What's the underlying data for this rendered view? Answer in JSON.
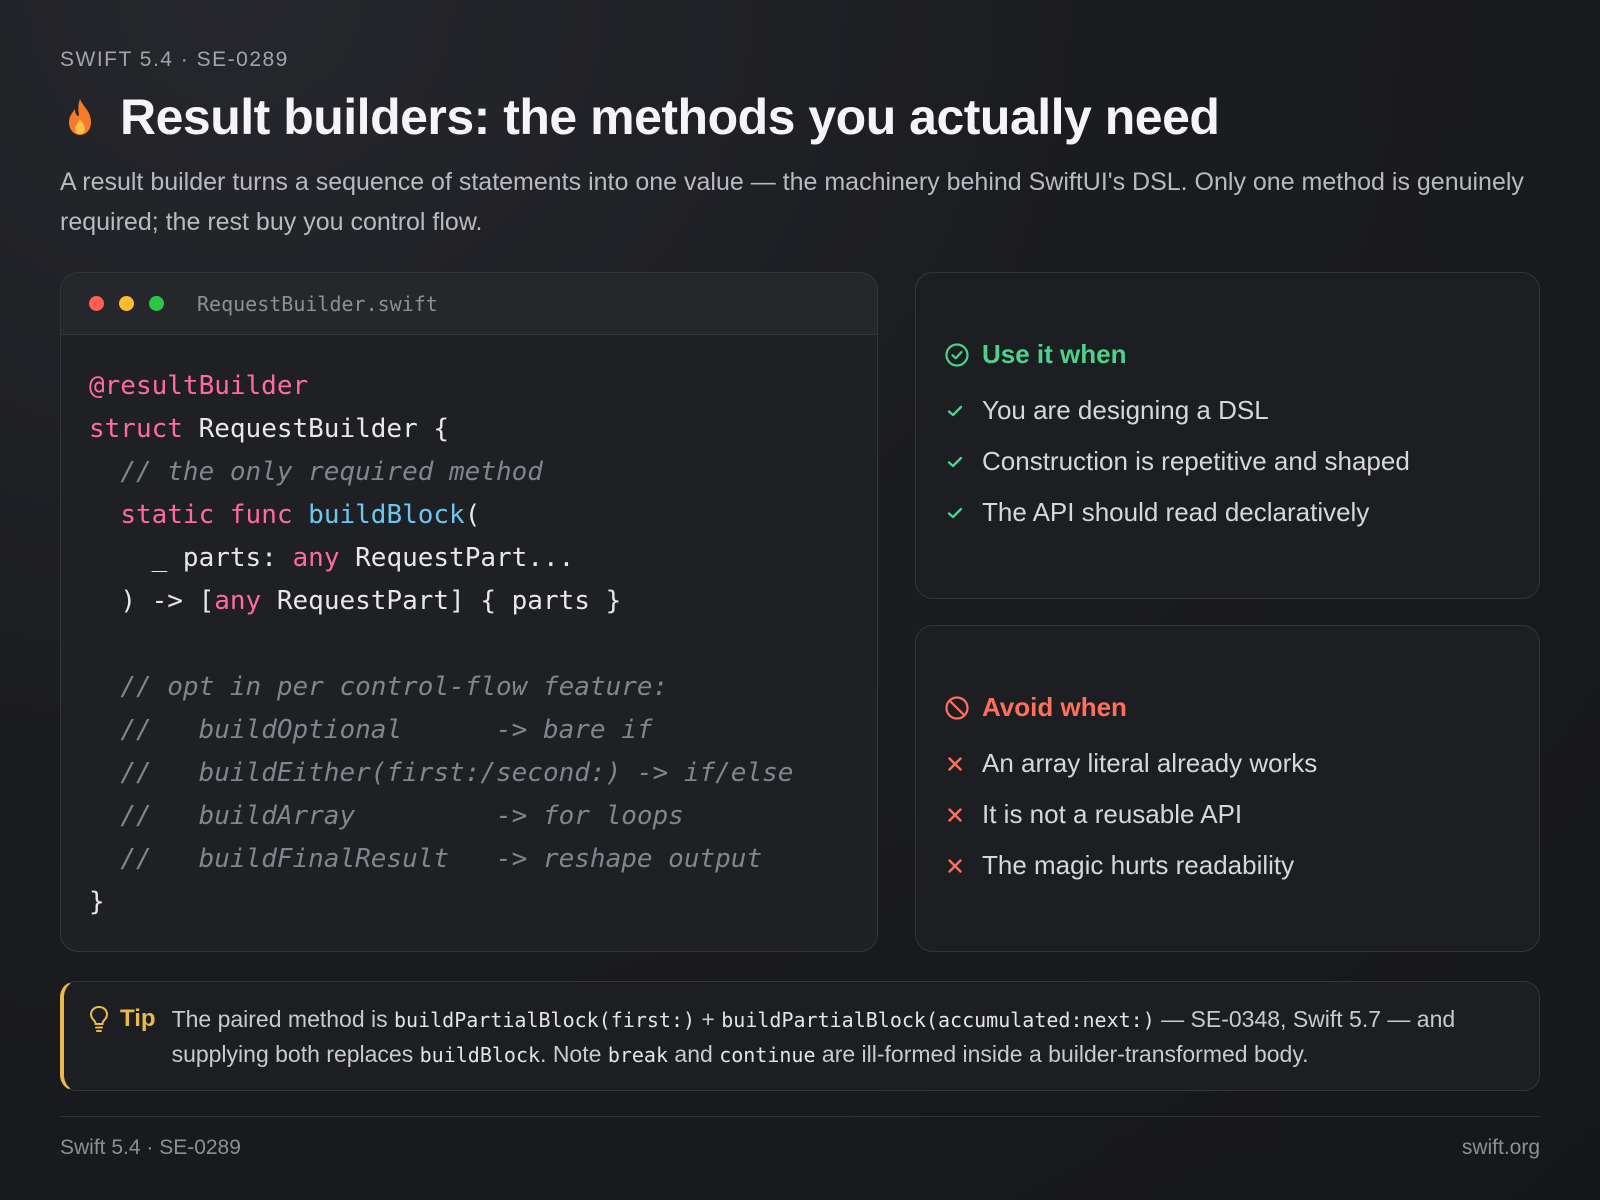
{
  "eyebrow": "SWIFT 5.4 · SE-0289",
  "title": "Result builders: the methods you actually need",
  "lede": "A result builder turns a sequence of statements into one value — the machinery behind SwiftUI's DSL. Only one method is genuinely required; the rest buy you control flow.",
  "code_window": {
    "filename": "RequestBuilder.swift",
    "lines": [
      {
        "indent": "",
        "parts": [
          {
            "t": "@resultBuilder",
            "c": "kw"
          }
        ]
      },
      {
        "indent": "",
        "parts": [
          {
            "t": "struct",
            "c": "kw"
          },
          {
            "t": " RequestBuilder {",
            "c": ""
          }
        ]
      },
      {
        "indent": "  ",
        "parts": [
          {
            "t": "// the only required method",
            "c": "cm"
          }
        ]
      },
      {
        "indent": "  ",
        "parts": [
          {
            "t": "static",
            "c": "kw"
          },
          {
            "t": " ",
            "c": ""
          },
          {
            "t": "func",
            "c": "kw"
          },
          {
            "t": " ",
            "c": ""
          },
          {
            "t": "buildBlock",
            "c": "fn"
          },
          {
            "t": "(",
            "c": ""
          }
        ]
      },
      {
        "indent": "    ",
        "parts": [
          {
            "t": "_ parts: ",
            "c": ""
          },
          {
            "t": "any",
            "c": "kw"
          },
          {
            "t": " RequestPart...",
            "c": ""
          }
        ]
      },
      {
        "indent": "  ",
        "parts": [
          {
            "t": ") -> [",
            "c": ""
          },
          {
            "t": "any",
            "c": "kw"
          },
          {
            "t": " RequestPart] { parts }",
            "c": ""
          }
        ]
      },
      {
        "indent": "",
        "parts": []
      },
      {
        "indent": "  ",
        "parts": [
          {
            "t": "// opt in per control-flow feature:",
            "c": "cm"
          }
        ]
      },
      {
        "indent": "  ",
        "parts": [
          {
            "t": "//   buildOptional      -> bare if",
            "c": "cm"
          }
        ]
      },
      {
        "indent": "  ",
        "parts": [
          {
            "t": "//   buildEither(first:/second:) -> if/else",
            "c": "cm"
          }
        ]
      },
      {
        "indent": "  ",
        "parts": [
          {
            "t": "//   buildArray         -> for loops",
            "c": "cm"
          }
        ]
      },
      {
        "indent": "  ",
        "parts": [
          {
            "t": "//   buildFinalResult   -> reshape output",
            "c": "cm"
          }
        ]
      },
      {
        "indent": "",
        "parts": [
          {
            "t": "}",
            "c": ""
          }
        ]
      }
    ]
  },
  "use_it_when": {
    "heading": "Use it when",
    "items": [
      "You are designing a DSL",
      "Construction is repetitive and shaped",
      "The API should read declaratively"
    ],
    "color": "#4fd08b"
  },
  "avoid_when": {
    "heading": "Avoid when",
    "items": [
      "An array literal already works",
      "It is not a reusable API",
      "The magic hurts readability"
    ],
    "color": "#ff6f5e"
  },
  "tip": {
    "label": "Tip",
    "t1": "The paired method is ",
    "c1": "buildPartialBlock(first:)",
    "t2": " + ",
    "c2": "buildPartialBlock(accumulated:next:)",
    "t3": " — SE-0348, Swift 5.7 — and supplying both replaces ",
    "c3": "buildBlock",
    "t4": ". Note ",
    "c4": "break",
    "t5": " and ",
    "c5": "continue",
    "t6": " are ill-formed inside a builder-transformed body.",
    "color": "#e9b949"
  },
  "footer": {
    "left": "Swift 5.4 · SE-0289",
    "right": "swift.org"
  }
}
